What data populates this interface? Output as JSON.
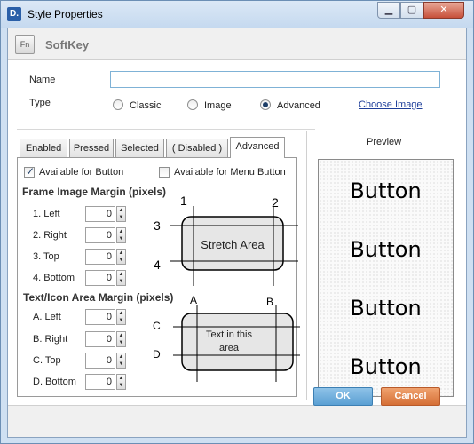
{
  "window": {
    "title": "Style Properties",
    "app_icon": "D."
  },
  "header": {
    "icon_label": "Fn",
    "title": "SoftKey"
  },
  "form": {
    "name_label": "Name",
    "name_value": "",
    "type_label": "Type",
    "type_options": [
      "Classic",
      "Image",
      "Advanced"
    ],
    "type_selected": "Advanced",
    "choose_image": "Choose Image"
  },
  "tabs": [
    "Enabled",
    "Pressed",
    "Selected",
    "( Disabled )",
    "Advanced"
  ],
  "active_tab": "Advanced",
  "advanced": {
    "avail_button": "Available for Button",
    "avail_button_checked": true,
    "avail_menu": "Available for Menu Button",
    "avail_menu_checked": false,
    "frame_title": "Frame Image Margin (pixels)",
    "frame_fields": [
      {
        "label": "1. Left",
        "value": "0"
      },
      {
        "label": "2. Right",
        "value": "0"
      },
      {
        "label": "3. Top",
        "value": "0"
      },
      {
        "label": "4. Bottom",
        "value": "0"
      }
    ],
    "frame_diagram": {
      "n1": "1",
      "n2": "2",
      "n3": "3",
      "n4": "4",
      "center": "Stretch Area"
    },
    "text_title": "Text/Icon Area Margin (pixels)",
    "text_fields": [
      {
        "label": "A. Left",
        "value": "0"
      },
      {
        "label": "B. Right",
        "value": "0"
      },
      {
        "label": "C. Top",
        "value": "0"
      },
      {
        "label": "D. Bottom",
        "value": "0"
      }
    ],
    "text_diagram": {
      "a": "A",
      "b": "B",
      "c": "C",
      "d": "D",
      "center": "Text in this area"
    }
  },
  "preview": {
    "label": "Preview",
    "buttons": [
      "Button",
      "Button",
      "Button",
      "Button"
    ]
  },
  "footer": {
    "ok": "OK",
    "cancel": "Cancel"
  },
  "colors": {
    "ok": "#5a9fd3",
    "cancel": "#d56f35",
    "title_bg": "#cfe0f2"
  }
}
